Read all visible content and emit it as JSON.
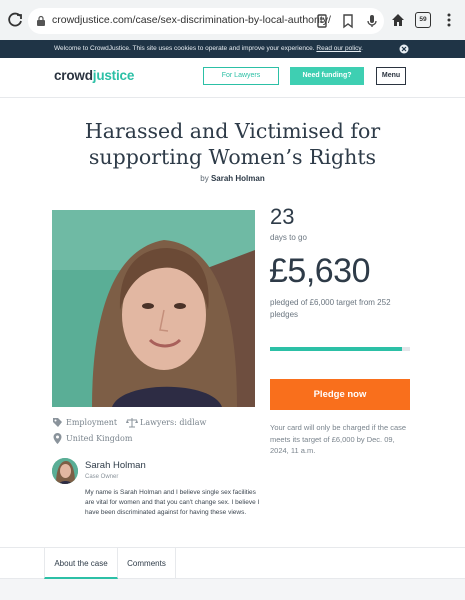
{
  "browser": {
    "url": "crowdjustice.com/case/sex-discrimination-by-local-authority/",
    "tab_count": "59"
  },
  "cookie_bar": {
    "text": "Welcome to CrowdJustice. This site uses cookies to operate and improve your experience. ",
    "link": "Read our policy"
  },
  "header": {
    "logo_crowd": "crowd",
    "logo_justice": "justice",
    "for_lawyers": "For Lawyers",
    "need_funding": "Need funding?",
    "menu": "Menu"
  },
  "case": {
    "title": "Harassed and Victimised for supporting Women’s Rights",
    "by_prefix": "by",
    "author": "Sarah Holman",
    "days_to_go": "23",
    "days_label": "days to go",
    "amount": "£5,630",
    "pledged_text": "pledged of £6,000 target from 252 pledges",
    "progress_fraction": 0.94,
    "pledge_button": "Pledge now",
    "charge_note": "Your card will only be charged if the case meets its target of £6,000 by Dec. 09, 2024, 11 a.m.",
    "category": "Employment",
    "lawyers": "Lawyers: didlaw",
    "location": "United Kingdom"
  },
  "owner": {
    "name": "Sarah Holman",
    "role": "Case Owner",
    "bio": "My name is Sarah Holman and I believe single sex facilities are vital for women and that you can't change sex. I believe I have been discriminated against for having these views."
  },
  "tabs": {
    "about": "About the case",
    "comments": "Comments"
  },
  "colors": {
    "accent": "#2cc0a6",
    "pledge": "#f96f1c",
    "cookie_bg": "#1f3446"
  }
}
